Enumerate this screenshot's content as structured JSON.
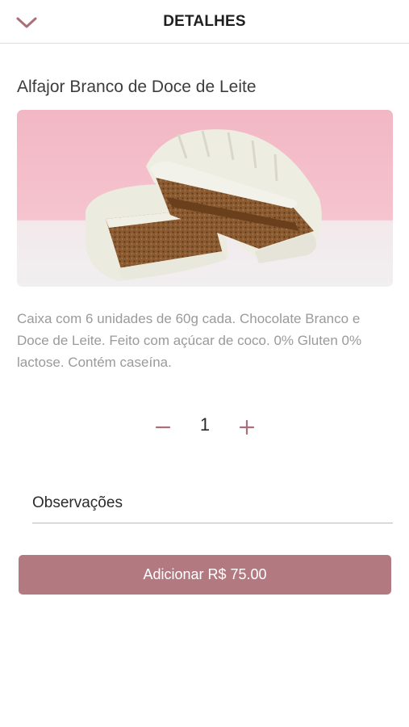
{
  "header": {
    "title": "DETALHES",
    "back_icon": "chevron-down-icon"
  },
  "product": {
    "name": "Alfajor Branco de Doce de Leite",
    "description": "Caixa com 6 unidades de 60g cada. Chocolate Branco e Doce de Leite. Feito com açúcar de coco. 0% Gluten 0% lactose. Contém caseína."
  },
  "quantity": {
    "value": "1",
    "minus_icon": "minus-icon",
    "plus_icon": "plus-icon"
  },
  "notes": {
    "placeholder": "Observações",
    "value": ""
  },
  "add_button": {
    "label": "Adicionar",
    "price": "R$ 75.00"
  },
  "colors": {
    "accent": "#b27a80",
    "icon": "#a8707a",
    "header_border": "#dddddd",
    "description_text": "#9a9a9a"
  }
}
